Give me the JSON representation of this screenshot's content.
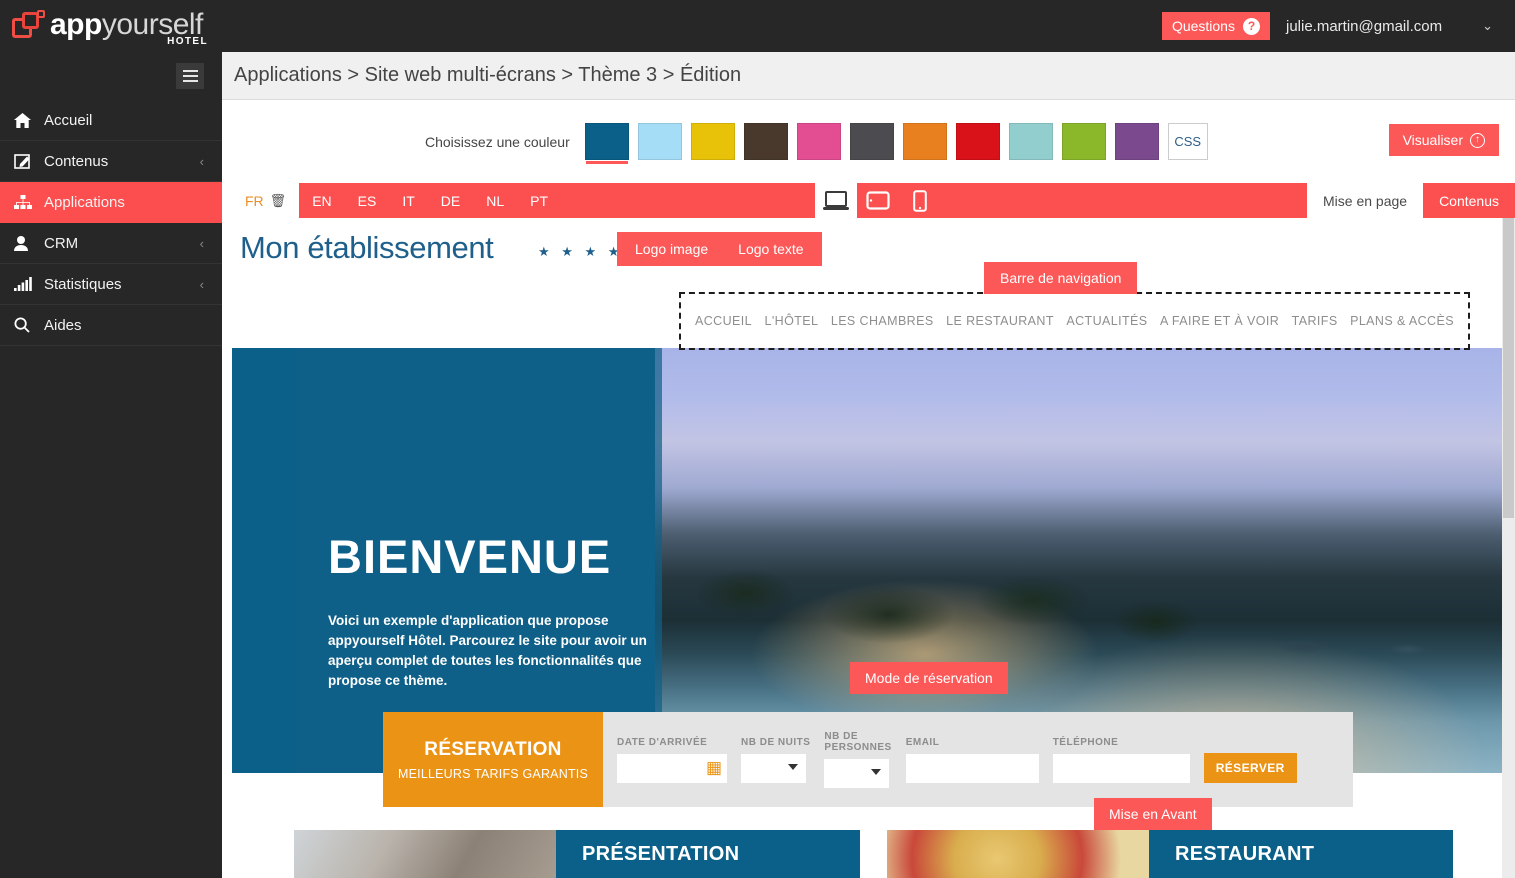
{
  "brand": {
    "name_bold": "app",
    "name_light": "yourself",
    "subtitle": "HOTEL",
    "logo_icon": "appyourself-squares-logo"
  },
  "topbar": {
    "questions_label": "Questions",
    "questions_icon": "question-mark-icon",
    "user_email": "julie.martin@gmail.com",
    "user_chevron_icon": "chevron-down-icon",
    "hamburger_icon": "hamburger-menu-icon"
  },
  "sidebar": {
    "items": [
      {
        "label": "Accueil",
        "icon": "home-icon",
        "active": false,
        "chevron": ""
      },
      {
        "label": "Contenus",
        "icon": "edit-icon",
        "active": false,
        "chevron": "‹"
      },
      {
        "label": "Applications",
        "icon": "sitemap-icon",
        "active": true,
        "chevron": ""
      },
      {
        "label": "CRM",
        "icon": "user-icon",
        "active": false,
        "chevron": "‹"
      },
      {
        "label": "Statistiques",
        "icon": "bar-chart-icon",
        "active": false,
        "chevron": "‹"
      },
      {
        "label": "Aides",
        "icon": "search-icon",
        "active": false,
        "chevron": ""
      }
    ]
  },
  "breadcrumb": {
    "text": "Applications > Site web multi-écrans > Thème 3 > Édition"
  },
  "colorbar": {
    "label": "Choisissez une couleur",
    "swatches": [
      {
        "name": "petrol-blue",
        "hex": "#0a6089",
        "selected": true
      },
      {
        "name": "light-blue",
        "hex": "#a5ddf7",
        "selected": false
      },
      {
        "name": "gold",
        "hex": "#e8c209",
        "selected": false
      },
      {
        "name": "dark-brown",
        "hex": "#48392c",
        "selected": false
      },
      {
        "name": "pink",
        "hex": "#e34d91",
        "selected": false
      },
      {
        "name": "dark-grey",
        "hex": "#4c4c50",
        "selected": false
      },
      {
        "name": "orange",
        "hex": "#e8801f",
        "selected": false
      },
      {
        "name": "red",
        "hex": "#d91119",
        "selected": false
      },
      {
        "name": "teal",
        "hex": "#93cece",
        "selected": false
      },
      {
        "name": "green",
        "hex": "#8bb82a",
        "selected": false
      },
      {
        "name": "purple",
        "hex": "#7b4a8e",
        "selected": false
      }
    ],
    "css_button": "CSS",
    "visualiser_label": "Visualiser",
    "visualiser_icon": "arrow-up-circle-icon",
    "accent_color": "#fc5858"
  },
  "langbar": {
    "languages": [
      {
        "code": "FR",
        "active": true,
        "delete_icon": "trash-icon"
      },
      {
        "code": "EN",
        "active": false,
        "delete_icon": ""
      },
      {
        "code": "ES",
        "active": false,
        "delete_icon": ""
      },
      {
        "code": "IT",
        "active": false,
        "delete_icon": ""
      },
      {
        "code": "DE",
        "active": false,
        "delete_icon": ""
      },
      {
        "code": "NL",
        "active": false,
        "delete_icon": ""
      },
      {
        "code": "PT",
        "active": false,
        "delete_icon": ""
      }
    ],
    "devices": [
      {
        "name": "desktop-icon",
        "active": true
      },
      {
        "name": "tablet-icon",
        "active": false
      },
      {
        "name": "mobile-icon",
        "active": false
      }
    ],
    "tabs": [
      {
        "label": "Mise en page",
        "active": true
      },
      {
        "label": "Contenus",
        "active": false
      }
    ]
  },
  "preview": {
    "site_title": "Mon établissement",
    "stars": "★ ★ ★ ★",
    "logo_image_label": "Logo image",
    "logo_texte_label": "Logo texte",
    "nav_badge_label": "Barre de navigation",
    "nav_links": [
      "ACCUEIL",
      "L'HÔTEL",
      "LES CHAMBRES",
      "LE RESTAURANT",
      "ACTUALITÉS",
      "A FAIRE ET À VOIR",
      "TARIFS",
      "PLANS & ACCÈS"
    ],
    "hero": {
      "title": "BIENVENUE",
      "body": "Voici un exemple d'application que propose appyourself Hôtel. Parcourez le site pour avoir un aperçu complet de toutes les fonctionnalités que propose ce thème."
    },
    "reservation_badge": "Mode de réservation",
    "reservation": {
      "title": "RÉSERVATION",
      "subtitle": "MEILLEURS TARIFS GARANTIS",
      "fields": [
        {
          "label": "DATE D'ARRIVÉE",
          "value": "",
          "icon": "calendar-icon",
          "type": "date"
        },
        {
          "label": "NB DE NUITS",
          "value": "",
          "icon": "chevron-down-icon",
          "type": "select"
        },
        {
          "label": "NB DE\nPERSONNES",
          "value": "",
          "icon": "chevron-down-icon",
          "type": "select"
        },
        {
          "label": "EMAIL",
          "value": "",
          "icon": "",
          "type": "text"
        },
        {
          "label": "TÉLÉPHONE",
          "value": "",
          "icon": "",
          "type": "text"
        }
      ],
      "submit_label": "RÉSERVER"
    },
    "highlight_badge": "Mise en Avant",
    "cards": [
      {
        "title": "PRÉSENTATION",
        "subtitle": ""
      },
      {
        "title": "RESTAURANT",
        "subtitle": ""
      }
    ]
  }
}
